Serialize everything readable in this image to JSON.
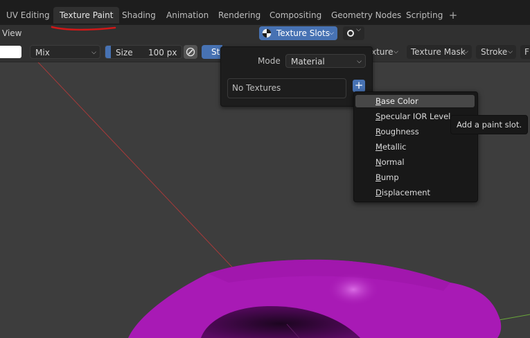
{
  "workspace_tabs": [
    {
      "label": "UV Editing"
    },
    {
      "label": "Texture Paint"
    },
    {
      "label": "Shading"
    },
    {
      "label": "Animation"
    },
    {
      "label": "Rendering"
    },
    {
      "label": "Compositing"
    },
    {
      "label": "Geometry Nodes"
    },
    {
      "label": "Scripting"
    }
  ],
  "active_tab": "Texture Paint",
  "add_tab_label": "+",
  "header": {
    "view_label": "View",
    "texture_slots_label": "Texture Slots"
  },
  "toolbar": {
    "blend_mode": "Mix",
    "size_label": "Size",
    "size_value": "100 px",
    "stroke_partial": "St",
    "texture_partial": "xture",
    "texture_mask_label": "Texture Mask",
    "stroke_label": "Stroke",
    "falloff_partial": "F"
  },
  "texture_slots_popup": {
    "mode_label": "Mode",
    "mode_value": "Material",
    "list_empty": "No Textures",
    "add_label": "+"
  },
  "paint_slot_menu": {
    "items": [
      {
        "label": "Base Color"
      },
      {
        "label": "Specular IOR Level"
      },
      {
        "label": "Roughness"
      },
      {
        "label": "Metallic"
      },
      {
        "label": "Normal"
      },
      {
        "label": "Bump"
      },
      {
        "label": "Displacement"
      }
    ],
    "hovered": "Base Color"
  },
  "tooltip": "Add a paint slot.",
  "colors": {
    "accent": "#4772b3",
    "mesh": "#a81ab5",
    "annotation": "#d01818"
  }
}
